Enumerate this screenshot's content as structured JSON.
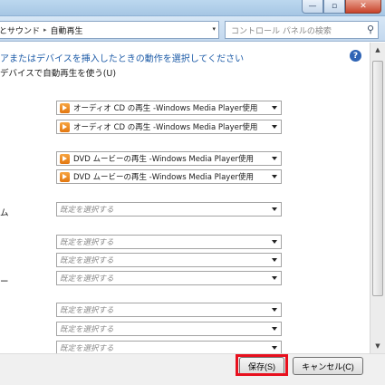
{
  "window": {
    "minimize_glyph": "—",
    "maximize_glyph": "▫",
    "close_glyph": "✕"
  },
  "address": {
    "parent": "とサウンド",
    "separator": "▸",
    "current": "自動再生",
    "dropdown_glyph": "▾"
  },
  "search": {
    "placeholder": "コントロール パネルの検索"
  },
  "page": {
    "heading": "アまたはデバイスを挿入したときの動作を選択してください",
    "checkbox_label": "デバイスで自動再生を使う(U)",
    "help_glyph": "?"
  },
  "rows": [
    {
      "label": "",
      "value": "オーディオ CD の再生 -Windows Media Player使用",
      "icon": "media-player-icon",
      "default": false
    },
    {
      "label": "",
      "value": "オーディオ CD の再生 -Windows Media Player使用",
      "icon": "media-player-icon",
      "default": false
    },
    {
      "label": "",
      "value": "DVD ムービーの再生 -Windows Media Player使用",
      "icon": "media-player-icon",
      "default": false
    },
    {
      "label": "",
      "value": "DVD ムービーの再生 -Windows Media Player使用",
      "icon": "media-player-icon",
      "default": false
    },
    {
      "label": "ム",
      "value": "既定を選択する",
      "icon": "",
      "default": true
    },
    {
      "label": "",
      "value": "既定を選択する",
      "icon": "",
      "default": true
    },
    {
      "label": "",
      "value": "既定を選択する",
      "icon": "",
      "default": true
    },
    {
      "label": "ー",
      "value": "既定を選択する",
      "icon": "",
      "default": true
    },
    {
      "label": "",
      "value": "既定を選択する",
      "icon": "",
      "default": true
    },
    {
      "label": "",
      "value": "既定を選択する",
      "icon": "",
      "default": true
    },
    {
      "label": "",
      "value": "既定を選択する",
      "icon": "",
      "default": true
    }
  ],
  "footer": {
    "save_label": "保存(S)",
    "cancel_label": "キャンセル(C)"
  },
  "colors": {
    "accent": "#1e5ca8",
    "highlight": "#e8101e"
  }
}
